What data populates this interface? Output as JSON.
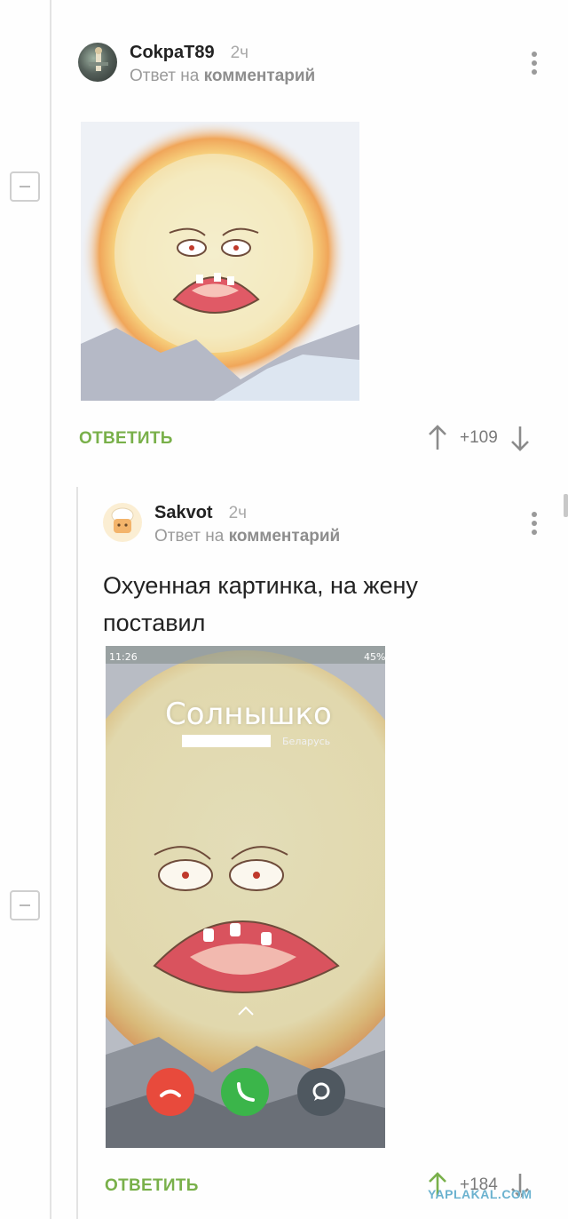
{
  "comments": [
    {
      "username": "CokpaT89",
      "time": "2ч",
      "reply_prefix": "Ответ на",
      "reply_target": "комментарий",
      "reply_label": "ОТВЕТИТЬ",
      "score": "+109",
      "image_alt": "scream-sun-image"
    },
    {
      "username": "Sakvot",
      "time": "2ч",
      "reply_prefix": "Ответ на",
      "reply_target": "комментарий",
      "text": "Охуенная картинка, на жену поставил",
      "reply_label": "ОТВЕТИТЬ",
      "score": "+184",
      "phone": {
        "status_time": "11:26",
        "battery": "45%",
        "caller_name": "Солнышко",
        "caller_region": "Беларусь"
      }
    }
  ],
  "watermark": "YAPLAKAL.COM",
  "colors": {
    "accent_green": "#79b04a",
    "decline_red": "#e84a3c",
    "accept_green": "#3bb54a",
    "message_gray": "#4f5860"
  },
  "icons": [
    "more-vertical-icon",
    "collapse-icon",
    "upvote-arrow-icon",
    "downvote-arrow-icon"
  ]
}
